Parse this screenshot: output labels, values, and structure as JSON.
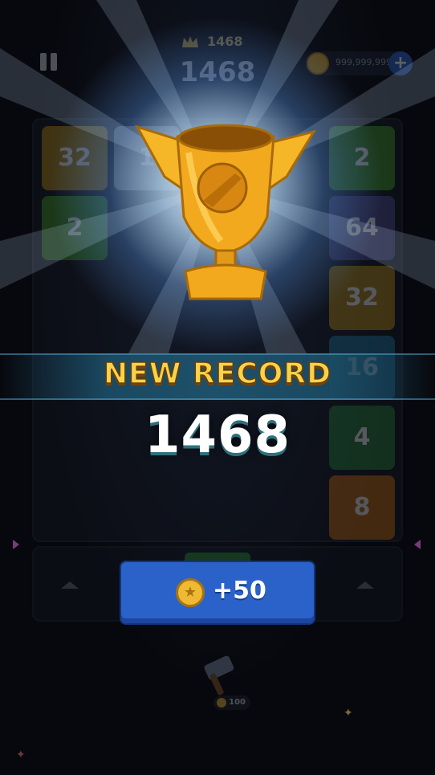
{
  "topbar": {
    "best_score": "1468",
    "current_score": "1468",
    "coins": "999,999,999",
    "add_coins_icon": "plus"
  },
  "board": {
    "tiles": [
      {
        "label": "32",
        "color": "#a5821b"
      },
      {
        "label": "1",
        "color": "#8c8f98"
      },
      {
        "label": "2",
        "color": "#3f8f2a"
      },
      {
        "label": "2",
        "color": "#3f8f2a"
      },
      {
        "label": "64",
        "color": "#4b4a8c"
      },
      {
        "label": "32",
        "color": "#a5821b"
      },
      {
        "label": "16",
        "color": "#1f6f96"
      },
      {
        "label": "4",
        "color": "#2b7a3f"
      },
      {
        "label": "8",
        "color": "#b5671a"
      }
    ]
  },
  "overlay": {
    "trophy_icon": "trophy-icon",
    "banner_text": "NEW RECORD",
    "new_score": "1468",
    "reward_label": "+50",
    "reward_icon": "coin-icon"
  },
  "powerup": {
    "icon": "hammer-icon",
    "cost": "100"
  },
  "colors": {
    "background": "#07080d",
    "banner_text": "#f7d34a",
    "reward_button": "#2a62c9"
  }
}
